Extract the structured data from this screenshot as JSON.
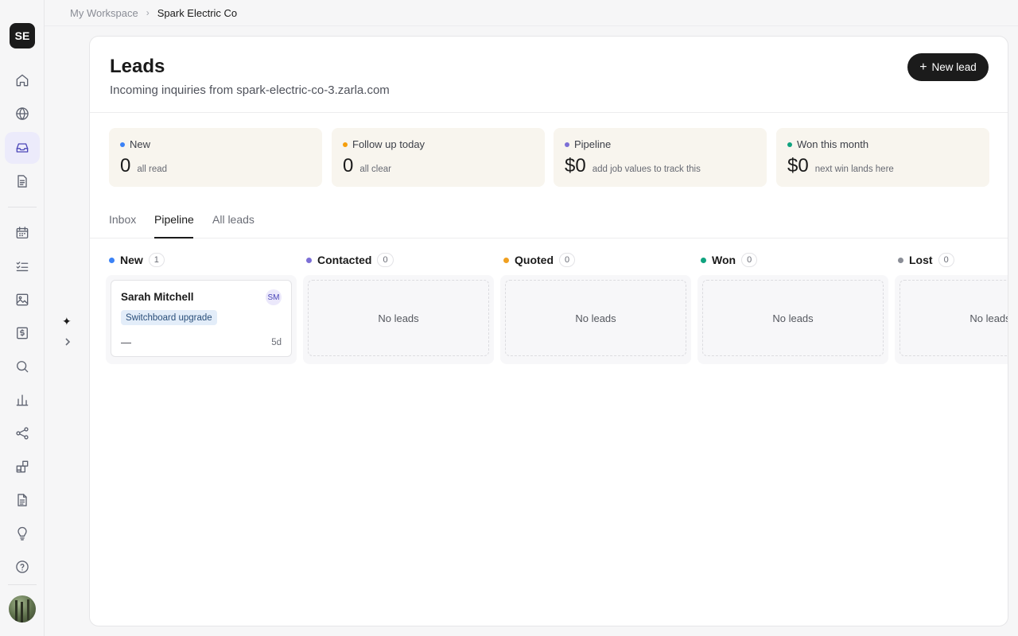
{
  "workspace": {
    "initials": "SE"
  },
  "breadcrumb": {
    "home": "My Workspace",
    "separator": "›",
    "current": "Spark Electric Co"
  },
  "page": {
    "title": "Leads",
    "subtitle": "Incoming inquiries from spark-electric-co-3.zarla.com",
    "new_lead_label": "New lead",
    "new_lead_icon": "+"
  },
  "stats": [
    {
      "label": "New",
      "value": "0",
      "note": "all read",
      "color": "#3b82f6"
    },
    {
      "label": "Follow up today",
      "value": "0",
      "note": "all clear",
      "color": "#f59e0b"
    },
    {
      "label": "Pipeline",
      "value": "$0",
      "note": "add job values to track this",
      "color": "#7c6fd6"
    },
    {
      "label": "Won this month",
      "value": "$0",
      "note": "next win lands here",
      "color": "#10a37f"
    }
  ],
  "tabs": [
    {
      "label": "Inbox",
      "active": false
    },
    {
      "label": "Pipeline",
      "active": true
    },
    {
      "label": "All leads",
      "active": false
    }
  ],
  "columns": [
    {
      "name": "New",
      "count": "1",
      "color": "#3b82f6"
    },
    {
      "name": "Contacted",
      "count": "0",
      "color": "#7c6fd6",
      "empty": "No leads"
    },
    {
      "name": "Quoted",
      "count": "0",
      "color": "#f0a020",
      "empty": "No leads"
    },
    {
      "name": "Won",
      "count": "0",
      "color": "#10a37f",
      "empty": "No leads"
    },
    {
      "name": "Lost",
      "count": "0",
      "color": "#8a8d96",
      "empty": "No leads"
    }
  ],
  "lead_card": {
    "name": "Sarah Mitchell",
    "initials": "SM",
    "tag": "Switchboard upgrade",
    "value": "—",
    "age": "5d"
  },
  "sidebar": {
    "icons": [
      "home-icon",
      "globe-icon",
      "inbox-icon",
      "document-icon",
      "calendar-icon",
      "checklist-icon",
      "image-icon",
      "invoice-icon",
      "search-icon",
      "chart-icon",
      "share-icon",
      "apps-icon",
      "file-icon",
      "lightbulb-icon",
      "help-icon"
    ],
    "active": "inbox-icon"
  },
  "assistant": {
    "sparkle": "✦"
  }
}
